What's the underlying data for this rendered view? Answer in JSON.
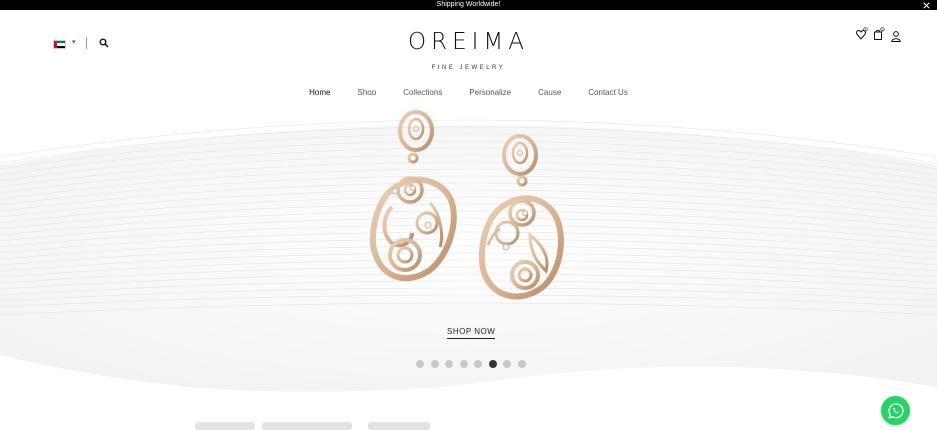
{
  "announcement": {
    "text": "Shipping Worldwide!"
  },
  "header": {
    "logo": "OREIMA",
    "tagline": "FINE JEWELRY",
    "country_flag": "uae-flag",
    "icons": [
      "search-icon",
      "wishlist-icon",
      "cart-icon",
      "account-icon"
    ],
    "wishlist_count": "0",
    "cart_count": "0"
  },
  "nav": {
    "items": [
      {
        "label": "Home",
        "active": true
      },
      {
        "label": "Shop"
      },
      {
        "label": "Collections"
      },
      {
        "label": "Personalize"
      },
      {
        "label": "Cause"
      },
      {
        "label": "Contact Us"
      }
    ]
  },
  "hero": {
    "cta": "SHOP NOW",
    "slide_count": 8,
    "active_slide": 6
  },
  "colors": {
    "gold": "#d9b89a",
    "gold_dark": "#b8916e",
    "whatsapp": "#25d366"
  }
}
